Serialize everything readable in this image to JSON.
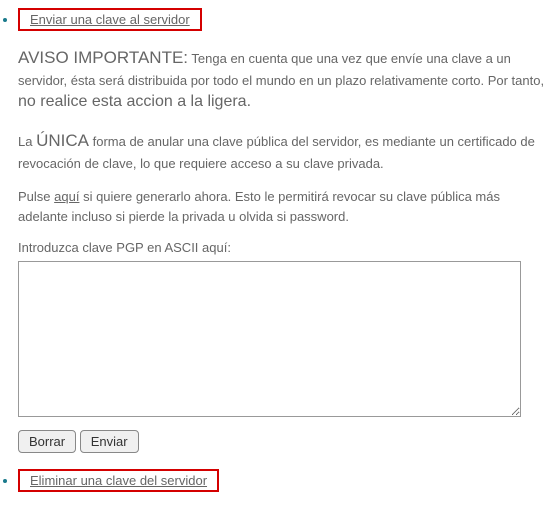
{
  "item1": {
    "link": "Enviar una clave al servidor",
    "notice": {
      "heading": "AVISO IMPORTANTE:",
      "part1": "Tenga en cuenta que una vez que envíe una clave a un servidor, ésta será distribuida por todo el mundo en un plazo relativamente corto. Por tanto, ",
      "strong": "no realice esta accion a la ligera."
    },
    "unique": {
      "pre": "La ",
      "word": "ÚNICA",
      "post": " forma de anular una clave pública del servidor, es mediante un certificado de revocación de clave, lo que requiere acceso a su clave privada."
    },
    "generate": {
      "pre": "Pulse ",
      "link": "aquí",
      "post": " si quiere generarlo ahora. Esto le permitirá revocar su clave pública más adelante incluso si pierde la privada u olvida si password."
    },
    "prompt": "Introduzca clave PGP en ASCII aquí:",
    "textarea_value": "",
    "buttons": {
      "clear": "Borrar",
      "submit": "Enviar"
    }
  },
  "item2": {
    "link": "Eliminar una clave del servidor"
  }
}
